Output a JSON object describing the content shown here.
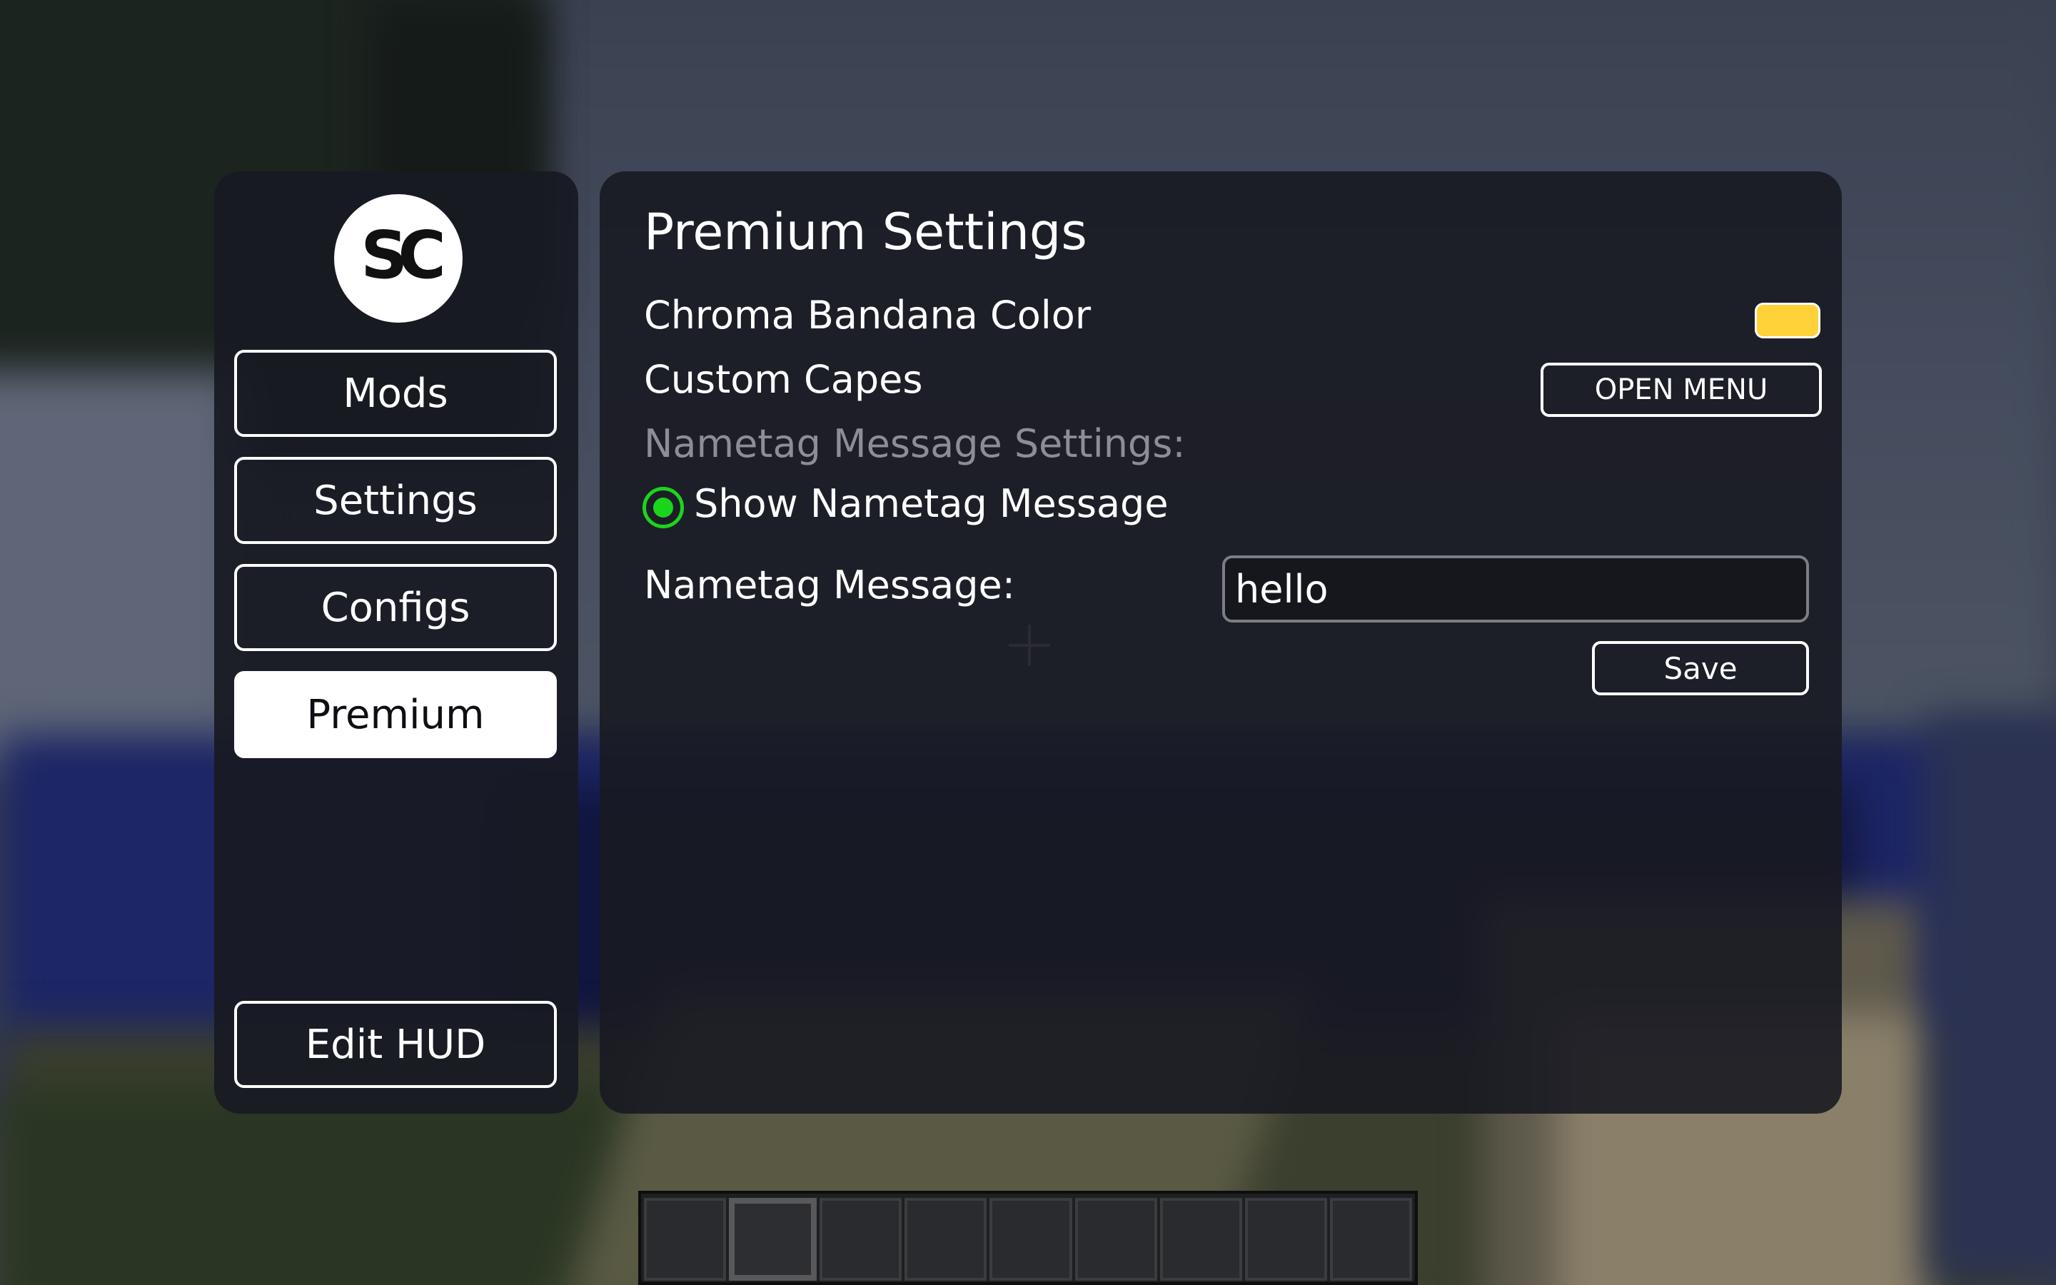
{
  "sidebar": {
    "logo_alt": "SC",
    "nav": [
      {
        "label": "Mods",
        "active": false
      },
      {
        "label": "Settings",
        "active": false
      },
      {
        "label": "Configs",
        "active": false
      },
      {
        "label": "Premium",
        "active": true
      }
    ],
    "edit_hud_label": "Edit HUD"
  },
  "main": {
    "title": "Premium Settings",
    "chroma_bandana": {
      "label": "Chroma Bandana Color",
      "color": "#ffd23a"
    },
    "custom_capes": {
      "label": "Custom Capes",
      "button_label": "OPEN MENU"
    },
    "nametag_section": {
      "header": "Nametag Message Settings:",
      "show_label": "Show Nametag Message",
      "show_enabled": true,
      "message_label": "Nametag Message:",
      "message_value": "hello",
      "save_label": "Save"
    }
  },
  "hotbar": {
    "slot_count": 9,
    "selected_slot": 2
  },
  "colors": {
    "panel_bg": "#181a22",
    "accent_green": "#1bd51b",
    "active_tab_bg": "#ffffff",
    "swatch_yellow": "#ffd23a"
  },
  "icons": {
    "logo": "sc-logo-icon",
    "radio": "radio-on-icon",
    "crosshair": "crosshair-icon"
  }
}
